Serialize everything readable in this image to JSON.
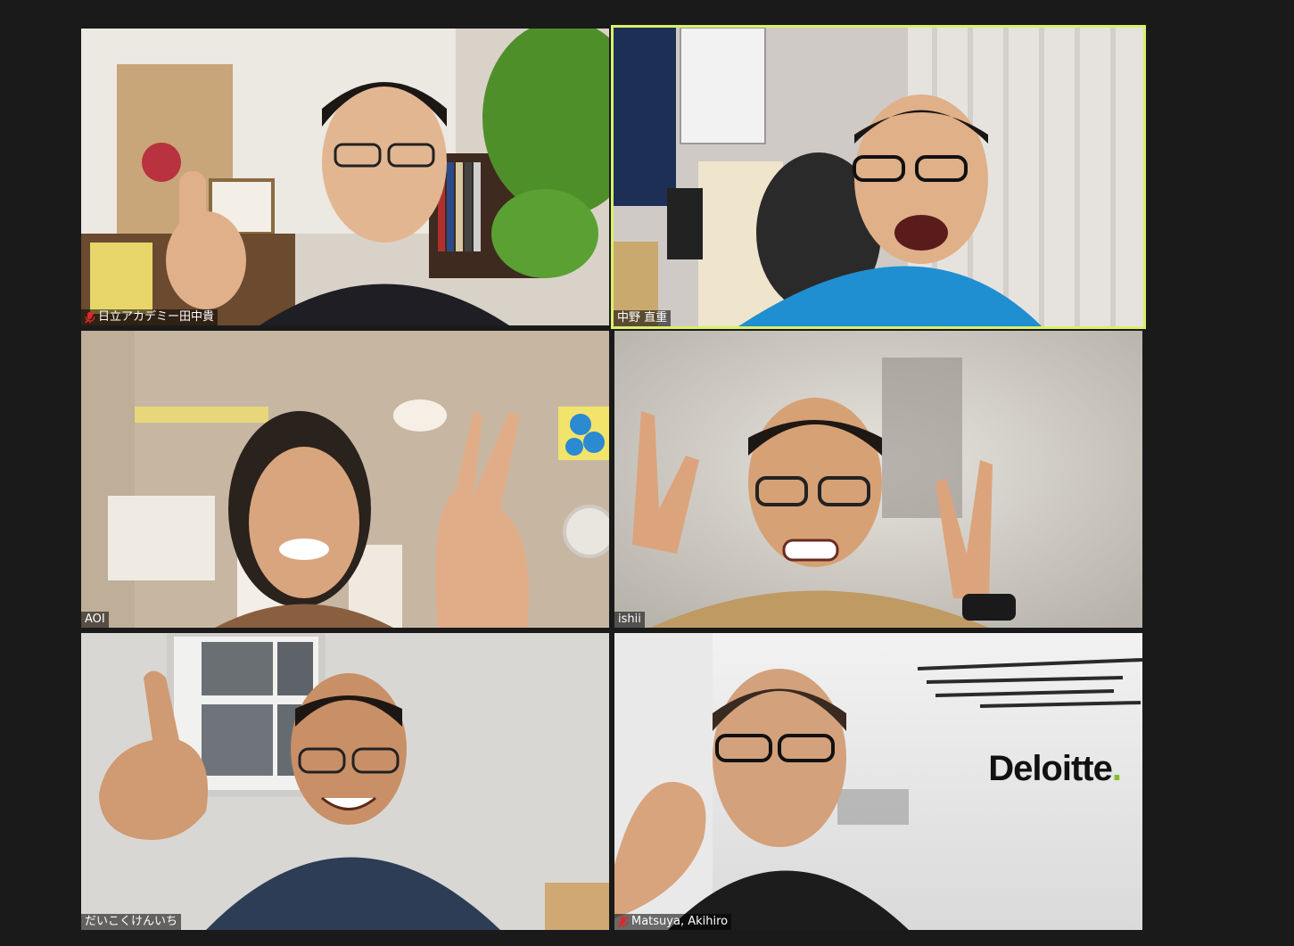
{
  "participants": [
    {
      "name": "日立アカデミー田中貴",
      "muted": true,
      "active": false
    },
    {
      "name": "中野 直重",
      "muted": false,
      "active": true
    },
    {
      "name": "AOI",
      "muted": false,
      "active": false
    },
    {
      "name": "ishii",
      "muted": false,
      "active": false
    },
    {
      "name": "だいこくけんいち",
      "muted": false,
      "active": false
    },
    {
      "name": "Matsuya, Akihiro",
      "muted": true,
      "active": false
    }
  ],
  "background_brand": {
    "text": "Deloitte",
    "dot": ".",
    "dot_color": "#86bc25"
  },
  "colors": {
    "active_speaker_border": "#d9f06a",
    "muted_icon": "#e02828",
    "window_bg": "#1a1a1a"
  },
  "icons": {
    "muted": "microphone-muted-icon"
  }
}
